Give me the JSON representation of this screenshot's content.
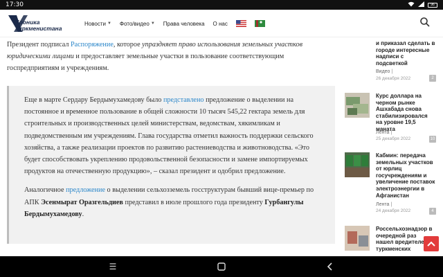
{
  "status": {
    "time": "17:30",
    "battery": "96"
  },
  "header": {
    "logo_line1": "Хроника",
    "logo_line2": "Туркменистана",
    "nav": [
      {
        "label": "Новости",
        "dropdown": true
      },
      {
        "label": "Фото/видео",
        "dropdown": true
      },
      {
        "label": "Права человека",
        "dropdown": false
      },
      {
        "label": "О нас",
        "dropdown": false
      }
    ]
  },
  "article": {
    "intro_1": "Президент подписал ",
    "intro_link": "Распоряжение",
    "intro_2": ", которое ",
    "intro_em": "упраздняет право использования земельных участков юридическими лицами",
    "intro_3": " и предоставляет земельные участки в пользование соответствующим госпредприятиям и учреждениям.",
    "q1_a": "Еще в марте Сердару Бердымухамедову было ",
    "q1_link": "представлено",
    "q1_b": " предложение о выделении на постоянное и временное пользование в общей сложности 10 тысяч 545,22 гектара земель для строительных и производственных целей министерствам, ведомствам, хякимликам и подведомственным им учреждениям. Глава государства отметил важность поддержки сельского хозяйства, а также реализации проектов по развитию растениеводства и животноводства. «Это будет способствовать укреплению продовольственной безопасности и замене импортируемых продуктов на отечественную продукцию», – сказал президент и одобрил предложение.",
    "q2_a": "Аналогичное ",
    "q2_link": "предложение",
    "q2_b": " о выделении сельхозземель госструктурам бывший вице-премьер по АПК ",
    "q2_bold1": "Эсенмырат Оразгельдиев",
    "q2_c": " представил в июле прошлого года президенту ",
    "q2_bold2": "Гурбангулы Бердымухамедову",
    "q2_d": "."
  },
  "sidebar": {
    "items": [
      {
        "title": "и приказал сделать в городе интересные надписи с подсветкой",
        "title_top_partial": "про-и...",
        "category": "Видео",
        "date": "26 декабря 2022",
        "count": "2"
      },
      {
        "title": "Курс доллара на черном рынке Ашхабада снова стабилизировался на уровне 19,5 маната",
        "category": "Лента",
        "date": "25 декабря 2022",
        "count": "10"
      },
      {
        "title": "Кабмин: передача земельных участков от юрлиц госучреждениям и увеличение поставок электроэнергии в Афганистан",
        "category": "Лента",
        "date": "24 декабря 2022",
        "count": "4"
      },
      {
        "title": "Россельхознадзор в очередной раз нашел вредителей в туркменских",
        "category": "",
        "date": "",
        "count": ""
      }
    ]
  },
  "colors": {
    "link": "#2a86c9",
    "share": "#e23b3b",
    "quote_bg": "#f1f1f1"
  }
}
